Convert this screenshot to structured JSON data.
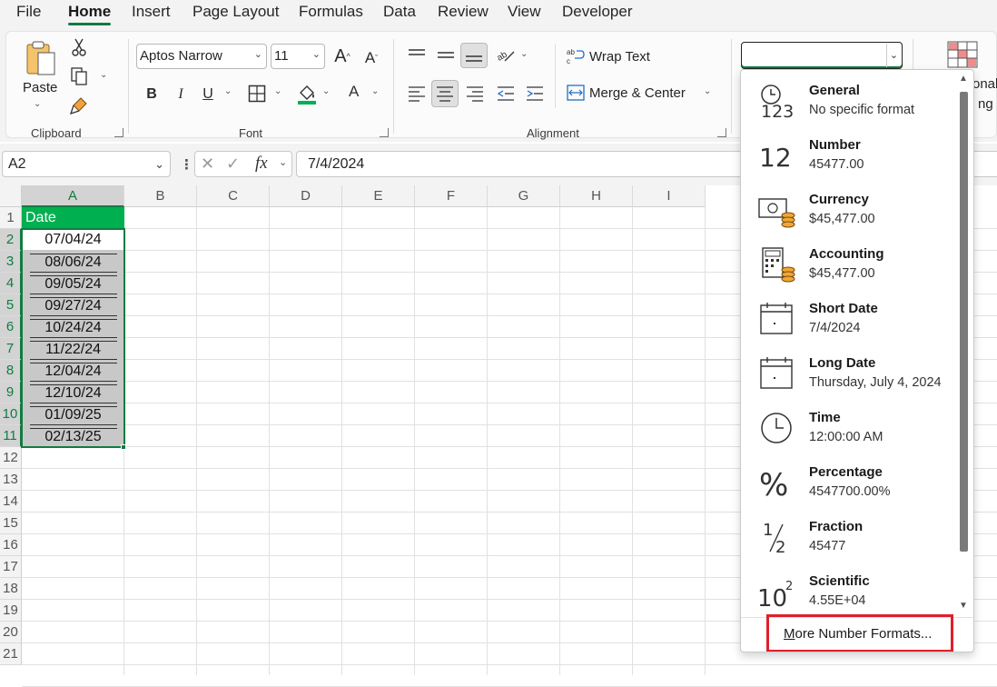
{
  "menu": {
    "tabs": [
      {
        "label": "File"
      },
      {
        "label": "Home"
      },
      {
        "label": "Insert"
      },
      {
        "label": "Page Layout"
      },
      {
        "label": "Formulas"
      },
      {
        "label": "Data"
      },
      {
        "label": "Review"
      },
      {
        "label": "View"
      },
      {
        "label": "Developer"
      }
    ],
    "active": "Home"
  },
  "ribbon": {
    "clipboard": {
      "label": "Clipboard",
      "paste_label": "Paste"
    },
    "font": {
      "label": "Font",
      "font_name": "Aptos Narrow",
      "font_size": "11",
      "bold": "B",
      "italic": "I",
      "underline": "U"
    },
    "alignment": {
      "label": "Alignment",
      "wrap_text": "Wrap Text",
      "merge_center": "Merge & Center"
    },
    "number_format_value": "",
    "partial_right_text": [
      "onal",
      "ng"
    ]
  },
  "formula_bar": {
    "name_box": "A2",
    "fx": "fx",
    "formula": "7/4/2024"
  },
  "grid": {
    "columns": [
      "A",
      "B",
      "C",
      "D",
      "E",
      "F",
      "G",
      "H",
      "I"
    ],
    "rows": [
      "1",
      "2",
      "3",
      "4",
      "5",
      "6",
      "7",
      "8",
      "9",
      "10",
      "11",
      "12",
      "13",
      "14",
      "15",
      "16",
      "17",
      "18",
      "19",
      "20",
      "21"
    ],
    "header_cell": "Date",
    "dates": [
      "07/04/24",
      "08/06/24",
      "09/05/24",
      "09/27/24",
      "10/24/24",
      "11/22/24",
      "12/04/24",
      "12/10/24",
      "01/09/25",
      "02/13/25"
    ]
  },
  "number_formats": {
    "options": [
      {
        "name": "General",
        "example": "No specific format",
        "icon": "clock-123-icon"
      },
      {
        "name": "Number",
        "example": "45477.00",
        "icon": "number-12-icon"
      },
      {
        "name": "Currency",
        "example": "$45,477.00",
        "icon": "currency-icon"
      },
      {
        "name": "Accounting",
        "example": " $45,477.00",
        "icon": "accounting-icon"
      },
      {
        "name": "Short Date",
        "example": "7/4/2024",
        "icon": "calendar-icon"
      },
      {
        "name": "Long Date",
        "example": "Thursday, July 4, 2024",
        "icon": "calendar-icon"
      },
      {
        "name": "Time",
        "example": "12:00:00 AM",
        "icon": "clock-icon"
      },
      {
        "name": "Percentage",
        "example": "4547700.00%",
        "icon": "percent-icon"
      },
      {
        "name": "Fraction",
        "example": "45477",
        "icon": "fraction-icon"
      },
      {
        "name": "Scientific",
        "example": "4.55E+04",
        "icon": "scientific-icon"
      }
    ],
    "more_label_first": "M",
    "more_label_rest": "ore Number Formats..."
  },
  "colors": {
    "accent": "#107c41",
    "header_fill": "#00b050",
    "highlight": "#e01f2a"
  }
}
